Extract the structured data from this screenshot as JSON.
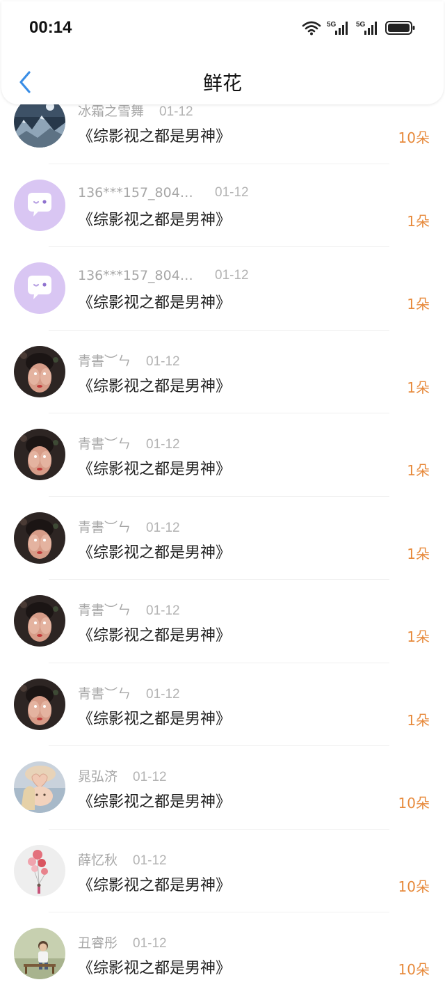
{
  "status_bar": {
    "time": "00:14",
    "wifi_icon": "wifi-icon",
    "signal_label_1": "5G",
    "signal_label_2": "5G",
    "battery_icon": "battery-icon"
  },
  "header": {
    "title": "鲜花",
    "back_icon": "back-chevron-icon"
  },
  "colors": {
    "accent_blue": "#3a8ee6",
    "count_orange": "#e78a3c",
    "meta_gray": "#a6a6a6"
  },
  "gifts": [
    {
      "username": "冰霜之雪舞",
      "date": "01-12",
      "book": "《综影视之都是男神》",
      "count": "10朵",
      "avatar": "mountain-night-avatar"
    },
    {
      "username": "136***157_8046...",
      "date": "01-12",
      "book": "《综影视之都是男神》",
      "count": "1朵",
      "avatar": "default-chat-avatar"
    },
    {
      "username": "136***157_8046...",
      "date": "01-12",
      "book": "《综影视之都是男神》",
      "count": "1朵",
      "avatar": "default-chat-avatar"
    },
    {
      "username": "青書︶ㄣ",
      "date": "01-12",
      "book": "《综影视之都是男神》",
      "count": "1朵",
      "avatar": "girl-covering-face-avatar"
    },
    {
      "username": "青書︶ㄣ",
      "date": "01-12",
      "book": "《综影视之都是男神》",
      "count": "1朵",
      "avatar": "girl-covering-face-avatar"
    },
    {
      "username": "青書︶ㄣ",
      "date": "01-12",
      "book": "《综影视之都是男神》",
      "count": "1朵",
      "avatar": "girl-covering-face-avatar"
    },
    {
      "username": "青書︶ㄣ",
      "date": "01-12",
      "book": "《综影视之都是男神》",
      "count": "1朵",
      "avatar": "girl-covering-face-avatar"
    },
    {
      "username": "青書︶ㄣ",
      "date": "01-12",
      "book": "《综影视之都是男神》",
      "count": "1朵",
      "avatar": "girl-covering-face-avatar"
    },
    {
      "username": "晁弘济",
      "date": "01-12",
      "book": "《综影视之都是男神》",
      "count": "10朵",
      "avatar": "heart-hands-avatar"
    },
    {
      "username": "薛忆秋",
      "date": "01-12",
      "book": "《综影视之都是男神》",
      "count": "10朵",
      "avatar": "balloons-avatar"
    },
    {
      "username": "丑睿彤",
      "date": "01-12",
      "book": "《综影视之都是男神》",
      "count": "10朵",
      "avatar": "boy-on-bench-avatar"
    }
  ]
}
